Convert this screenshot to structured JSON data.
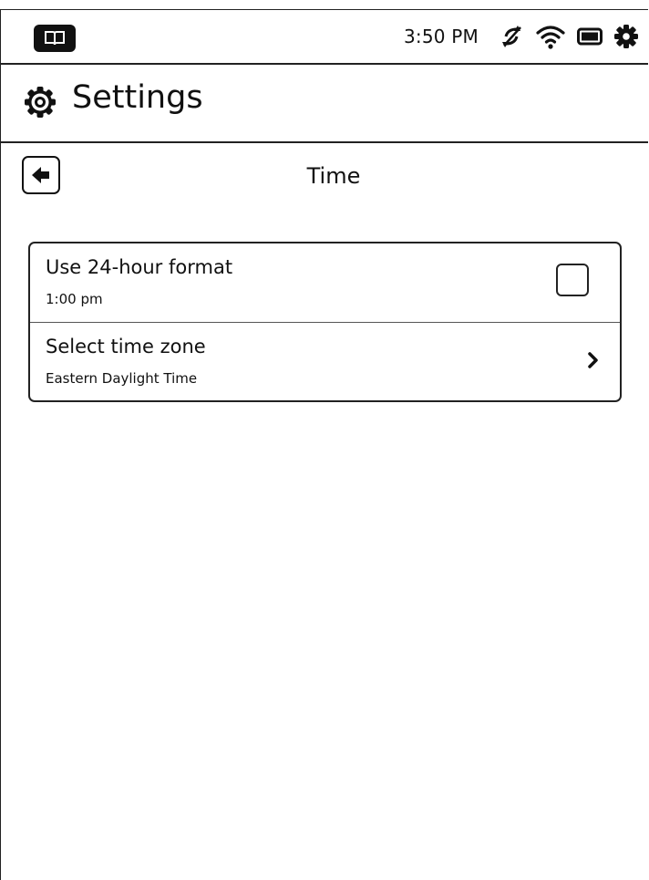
{
  "status_bar": {
    "time": "3:50 PM",
    "icons": [
      "book-icon",
      "sync-off-icon",
      "wifi-icon",
      "battery-icon",
      "gear-icon"
    ]
  },
  "header": {
    "title": "Settings",
    "icon": "gear-icon"
  },
  "sub_header": {
    "title": "Time",
    "back_icon": "arrow-left-icon"
  },
  "settings": {
    "items": [
      {
        "label": "Use 24-hour format",
        "sublabel": "1:00 pm",
        "control": "checkbox",
        "checked": false
      },
      {
        "label": "Select time zone",
        "sublabel": "Eastern Daylight Time",
        "control": "chevron-right-icon"
      }
    ]
  }
}
